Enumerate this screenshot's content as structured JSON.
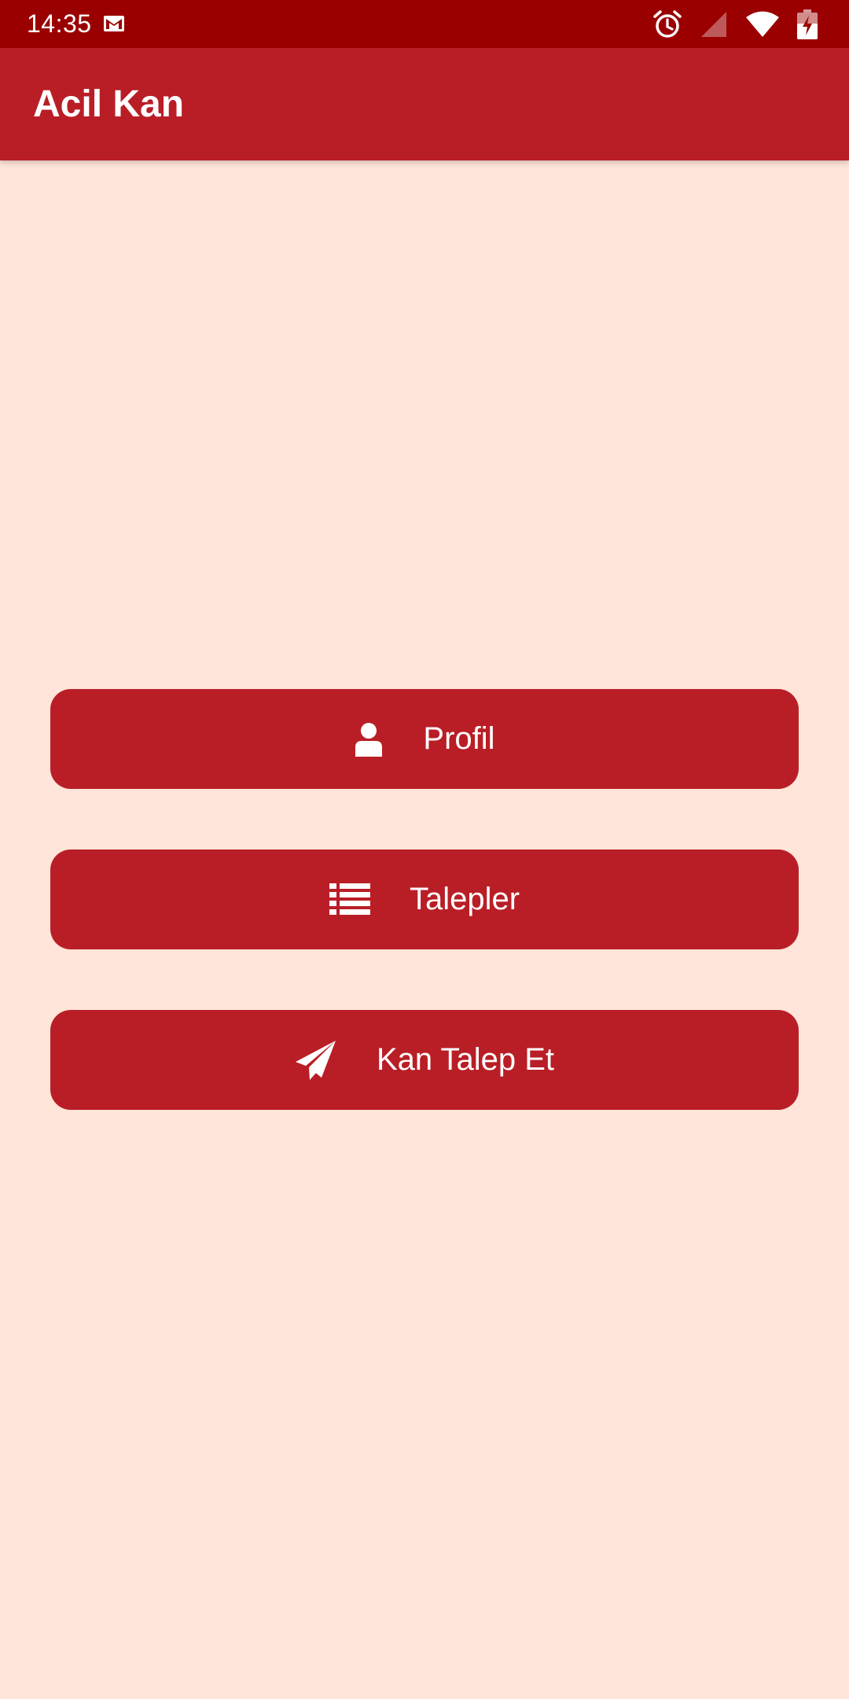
{
  "status_bar": {
    "time": "14:35",
    "icons": [
      "gmail-icon",
      "alarm-icon",
      "cellular-signal-icon",
      "wifi-icon",
      "battery-charging-icon"
    ],
    "background_color": "#9B0000"
  },
  "app_bar": {
    "title": "Acil Kan",
    "background_color": "#B91E26"
  },
  "main": {
    "background_color": "#FFE4D9",
    "buttons": [
      {
        "label": "Profil",
        "icon": "user-icon"
      },
      {
        "label": "Talepler",
        "icon": "list-icon"
      },
      {
        "label": "Kan Talep Et",
        "icon": "paper-plane-icon"
      }
    ]
  }
}
